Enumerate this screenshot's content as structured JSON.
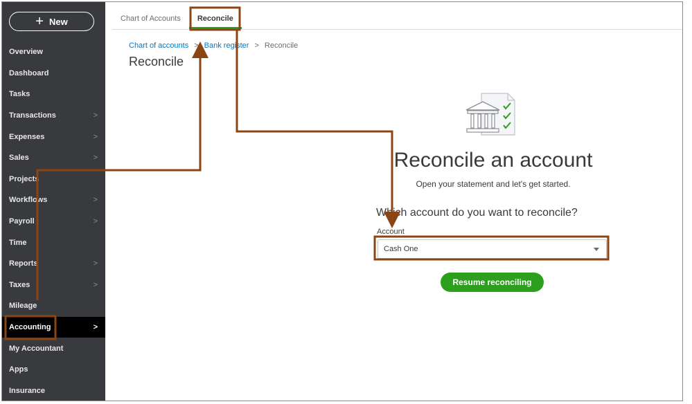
{
  "sidebar": {
    "new_label": "New",
    "items": [
      {
        "label": "Overview",
        "chevron": ""
      },
      {
        "label": "Dashboard",
        "chevron": ""
      },
      {
        "label": "Tasks",
        "chevron": ""
      },
      {
        "label": "Transactions",
        "chevron": ">"
      },
      {
        "label": "Expenses",
        "chevron": ">"
      },
      {
        "label": "Sales",
        "chevron": ">"
      },
      {
        "label": "Projects",
        "chevron": ""
      },
      {
        "label": "Workflows",
        "chevron": ">"
      },
      {
        "label": "Payroll",
        "chevron": ">"
      },
      {
        "label": "Time",
        "chevron": ""
      },
      {
        "label": "Reports",
        "chevron": ">"
      },
      {
        "label": "Taxes",
        "chevron": ">"
      },
      {
        "label": "Mileage",
        "chevron": ""
      },
      {
        "label": "Accounting",
        "chevron": ">"
      },
      {
        "label": "My Accountant",
        "chevron": ""
      },
      {
        "label": "Apps",
        "chevron": ""
      },
      {
        "label": "Insurance",
        "chevron": ""
      }
    ]
  },
  "tabs": [
    {
      "label": "Chart of Accounts"
    },
    {
      "label": "Reconcile"
    }
  ],
  "breadcrumb": {
    "items": [
      "Chart of accounts",
      "Bank register",
      "Reconcile"
    ],
    "separator": ">"
  },
  "page_title": "Reconcile",
  "content": {
    "headline": "Reconcile an account",
    "subline": "Open your statement and let's get started.",
    "question": "Which account do you want to reconcile?",
    "account_label": "Account",
    "account_value": "Cash One",
    "resume_label": "Resume reconciling"
  },
  "colors": {
    "sidebar_bg": "#393a3d",
    "accent_green": "#2ca01c",
    "link_blue": "#0077c5",
    "annotation": "#8b4513"
  }
}
